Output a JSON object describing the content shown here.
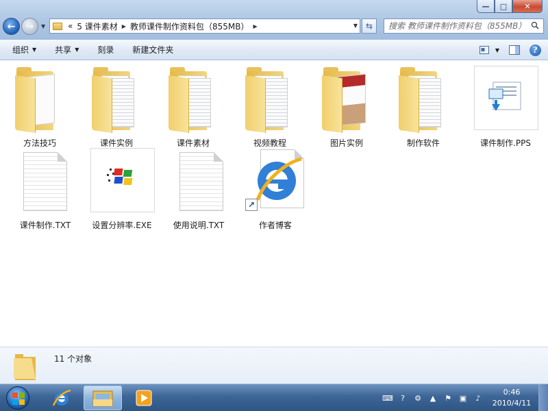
{
  "window": {
    "controls": {
      "minimize": "—",
      "maximize": "□",
      "close": "✕"
    }
  },
  "address": {
    "overflow": "«",
    "segments": [
      "5 课件素材",
      "教师课件制作资料包（855MB）"
    ]
  },
  "search": {
    "placeholder": "搜索 教师课件制作资料包（855MB）"
  },
  "toolbar": {
    "organize": "组织",
    "share": "共享",
    "burn": "刻录",
    "new_folder": "新建文件夹"
  },
  "items": [
    {
      "label": "方法技巧",
      "icon": "folder-icon"
    },
    {
      "label": "课件实例",
      "icon": "folder-icon"
    },
    {
      "label": "课件素材",
      "icon": "folder-icon"
    },
    {
      "label": "视频教程",
      "icon": "folder-icon"
    },
    {
      "label": "图片实例",
      "icon": "folder-icon"
    },
    {
      "label": "制作软件",
      "icon": "folder-icon"
    },
    {
      "label": "课件制作.PPS",
      "icon": "powerpoint-slideshow-icon"
    },
    {
      "label": "课件制作.TXT",
      "icon": "text-file-icon"
    },
    {
      "label": "设置分辨率.EXE",
      "icon": "windows-logo-exe-icon"
    },
    {
      "label": "使用说明.TXT",
      "icon": "text-file-icon"
    },
    {
      "label": "作者博客",
      "icon": "internet-explorer-shortcut-icon"
    }
  ],
  "details": {
    "count": "11 个对象"
  },
  "taskbar": {
    "time": "0:46",
    "date": "2010/4/11"
  },
  "colors": {
    "taskbar": "#3d6596",
    "toolbar": "#dfe9f5",
    "folder": "#f3d57c"
  }
}
